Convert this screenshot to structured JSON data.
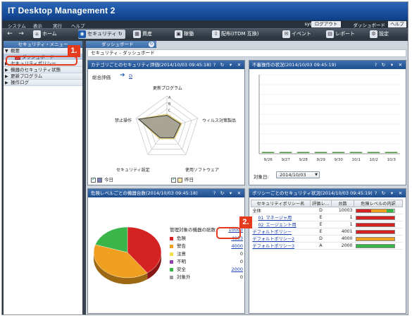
{
  "app": {
    "title": "IT Desktop Management 2"
  },
  "menu": {
    "items": [
      "システム",
      "表示",
      "実行",
      "ヘルプ"
    ],
    "system_user": "system",
    "logout": "ログアウト",
    "dashboard": "ダッシュボード",
    "help": "ヘルプ"
  },
  "toolbar": {
    "home": "ホーム",
    "security": "セキュリティ",
    "assets": "資産",
    "distribution_short": "稼働",
    "distribution": "配布(ITDM 互換)",
    "events": "イベント",
    "reports": "レポート",
    "settings": "設定"
  },
  "sidebar": {
    "header": "セキュリティ・メニュー",
    "items": [
      {
        "label": "概要"
      },
      {
        "label": "ダッシュボード"
      },
      {
        "label": "セキュリティポリシー"
      },
      {
        "label": "機器のセキュリティ状態"
      },
      {
        "label": "更新プログラム"
      },
      {
        "label": "操作ログ"
      }
    ]
  },
  "main": {
    "tab": "ダッシュボード",
    "breadcrumb": "セキュリティ - ダッシュボード"
  },
  "panels": {
    "radar": {
      "title": "カテゴリごとのセキュリティ評価(2014/10/03 09:45:18)",
      "overall_label": "総合評価",
      "overall_value": "D",
      "axes": [
        "更新プログラム",
        "ウィルス対策製品",
        "使用ソフトウェア",
        "セキュリティ設定",
        "禁止操作"
      ],
      "grades": [
        "A",
        "B",
        "C",
        "D",
        "E"
      ],
      "legend_today": "今日",
      "legend_yesterday": "昨日"
    },
    "unsafe_ops": {
      "title": "不審操作の状況(2014/10/03 09:45:19)",
      "dates": [
        "9/26",
        "9/27",
        "9/28",
        "9/29",
        "9/30",
        "10/1",
        "10/2",
        "10/3"
      ],
      "target_label": "対象日:",
      "target_date": "2014/10/03"
    },
    "risk_devices": {
      "title": "危険レベルごとの機器台数(2014/10/03 09:45:18)",
      "total_label": "管理対象の機器の総数",
      "total_value": "10003",
      "levels": [
        {
          "name": "危険",
          "value": "4003"
        },
        {
          "name": "警告",
          "value": "4000"
        },
        {
          "name": "注意",
          "value": "0"
        },
        {
          "name": "不明",
          "value": "0"
        },
        {
          "name": "安全",
          "value": "2000"
        },
        {
          "name": "対象外",
          "value": "0"
        }
      ]
    },
    "policy_status": {
      "title": "ポリシーごとのセキュリティ状況(2014/10/03 09:45:19)",
      "columns": [
        "セキュリティポリシー名",
        "評価レ…",
        "台数",
        "危険レベルの内訳"
      ],
      "rows": [
        {
          "name": "全体",
          "grade": "D",
          "count": "10003"
        },
        {
          "name": "01_マネージャ用",
          "grade": "E",
          "count": "1"
        },
        {
          "name": "02_エージェント用",
          "grade": "E",
          "count": "1"
        },
        {
          "name": "デフォルトポリシー",
          "grade": "E",
          "count": "4001"
        },
        {
          "name": "デフォルトポリシー2",
          "grade": "D",
          "count": "4000"
        },
        {
          "name": "デフォルトポリシー3",
          "grade": "A",
          "count": "2000"
        }
      ]
    }
  },
  "chart_data": [
    {
      "type": "pie",
      "categories": [
        "危険",
        "警告",
        "注意",
        "不明",
        "安全",
        "対象外"
      ],
      "values": [
        4003,
        4000,
        0,
        0,
        2000,
        0
      ],
      "colors": [
        "#d42222",
        "#f0a020",
        "#f3e14a",
        "#8e44ad",
        "#39b54a",
        "#9a9a9a"
      ]
    },
    {
      "type": "bar",
      "categories": [
        "9/26",
        "9/27",
        "9/28",
        "9/29",
        "9/30",
        "10/1",
        "10/2",
        "10/3"
      ],
      "values": [
        0,
        0,
        0,
        0,
        0,
        0,
        0,
        0
      ]
    }
  ],
  "callouts": [
    "1.",
    "2."
  ],
  "colors": {
    "accent": "#1c5aa8",
    "danger": "#d42222",
    "warning": "#f0a020",
    "safe": "#39b54a",
    "callout": "#e53b1c"
  }
}
